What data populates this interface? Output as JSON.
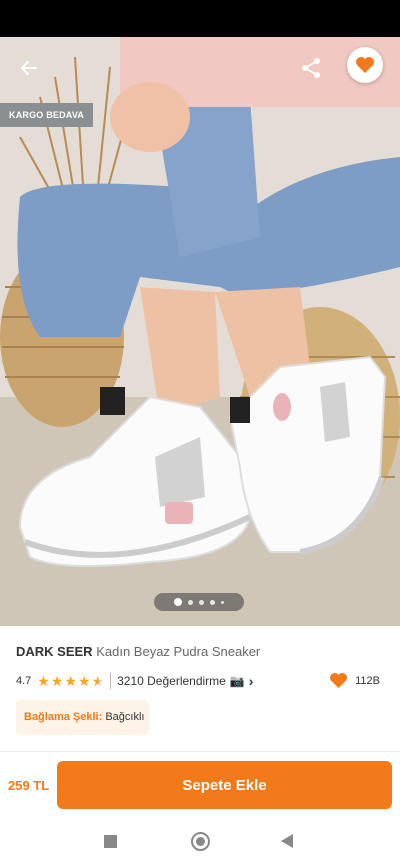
{
  "gallery": {
    "badge": "KARGO BEDAVA",
    "image_description_icon": "photo-icon",
    "page_indicator": {
      "count": 5,
      "active_index": 0
    }
  },
  "product": {
    "brand": "DARK SEER",
    "name": "Kadın Beyaz Pudra Sneaker",
    "rating": "4.7",
    "stars_filled": 4.5,
    "reviews": "3210 Değerlendirme",
    "likes": "112B",
    "attribute_label": "Bağlama Şekli:",
    "attribute_value": "Bağcıklı"
  },
  "purchase": {
    "price": "259 TL",
    "add_to_cart": "Sepete Ekle"
  },
  "colors": {
    "accent": "#f27a1a",
    "star": "#f5a623",
    "badge_bg": "#8a8f91"
  }
}
